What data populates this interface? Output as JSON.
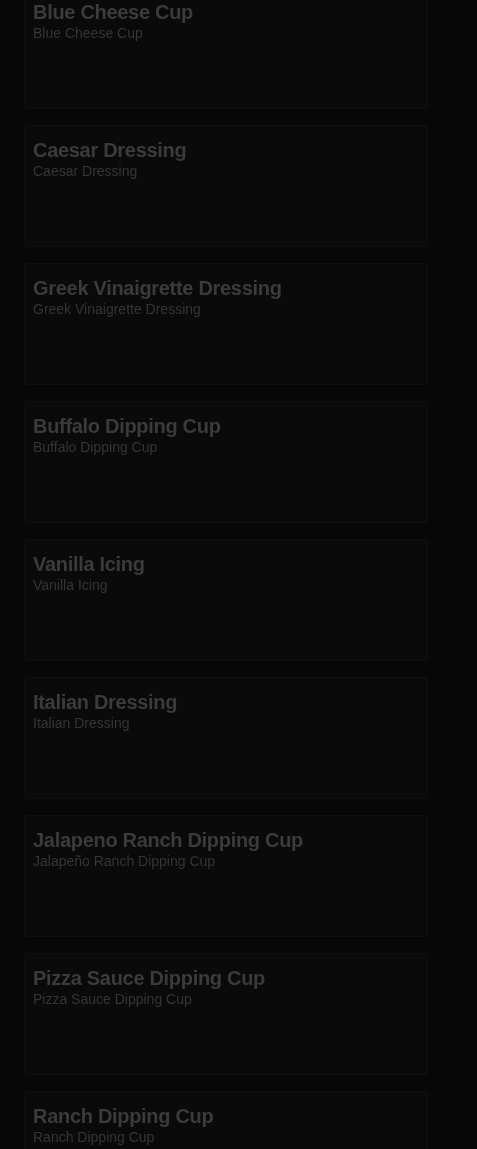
{
  "items": [
    {
      "title": "Blue Cheese Cup",
      "subtitle": "Blue Cheese Cup"
    },
    {
      "title": "Caesar Dressing",
      "subtitle": "Caesar Dressing"
    },
    {
      "title": "Greek Vinaigrette Dressing",
      "subtitle": "Greek Vinaigrette Dressing"
    },
    {
      "title": "Buffalo Dipping Cup",
      "subtitle": "Buffalo Dipping Cup"
    },
    {
      "title": "Vanilla Icing",
      "subtitle": "Vanilla Icing"
    },
    {
      "title": "Italian Dressing",
      "subtitle": "Italian Dressing"
    },
    {
      "title": "Jalapeno Ranch Dipping Cup",
      "subtitle": "Jalapeño Ranch Dipping Cup"
    },
    {
      "title": "Pizza Sauce Dipping Cup",
      "subtitle": "Pizza Sauce Dipping Cup"
    },
    {
      "title": "Ranch Dipping Cup",
      "subtitle": "Ranch Dipping Cup"
    }
  ]
}
